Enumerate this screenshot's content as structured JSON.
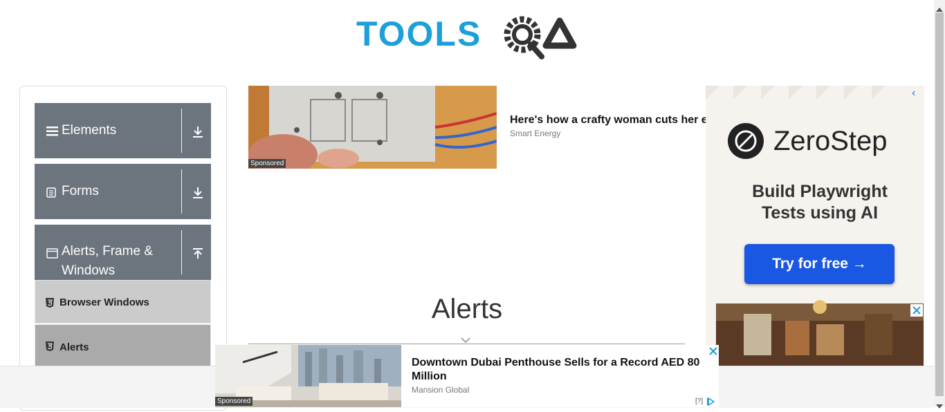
{
  "logo": {
    "text_left": "TOOLS",
    "text_right": "QA",
    "color_blue": "#1d9fd9",
    "color_dark": "#333333"
  },
  "sidebar": {
    "groups": [
      {
        "label": "Elements",
        "icon": "hamburger-icon",
        "arrow": "download-icon"
      },
      {
        "label": "Forms",
        "icon": "document-icon",
        "arrow": "download-icon"
      },
      {
        "label": "Alerts, Frame & Windows",
        "icon": "window-icon",
        "arrow": "upload-icon"
      }
    ],
    "items": [
      {
        "label": "Browser Windows",
        "icon": "html5-icon"
      },
      {
        "label": "Alerts",
        "icon": "html5-icon"
      }
    ]
  },
  "ad_top": {
    "sponsored": "Sponsored",
    "title": "Here's how a crafty woman cuts her e",
    "source": "Smart Energy"
  },
  "main": {
    "heading": "Alerts"
  },
  "right_ad": {
    "brand": "ZeroStep",
    "tagline": "Build Playwright Tests using AI",
    "cta": "Try for free →",
    "chevron": "‹"
  },
  "bottom_ad": {
    "sponsored": "Sponsored",
    "title": "Downtown Dubai Penthouse Sells for a Record AED 80 Million",
    "source": "Mansion Global",
    "info": "[?]"
  },
  "colors": {
    "sidebar_group": "#6c757d",
    "item_active": "#cbcbcb",
    "item_selected": "#aaaaaa",
    "cta": "#1a57e3"
  }
}
